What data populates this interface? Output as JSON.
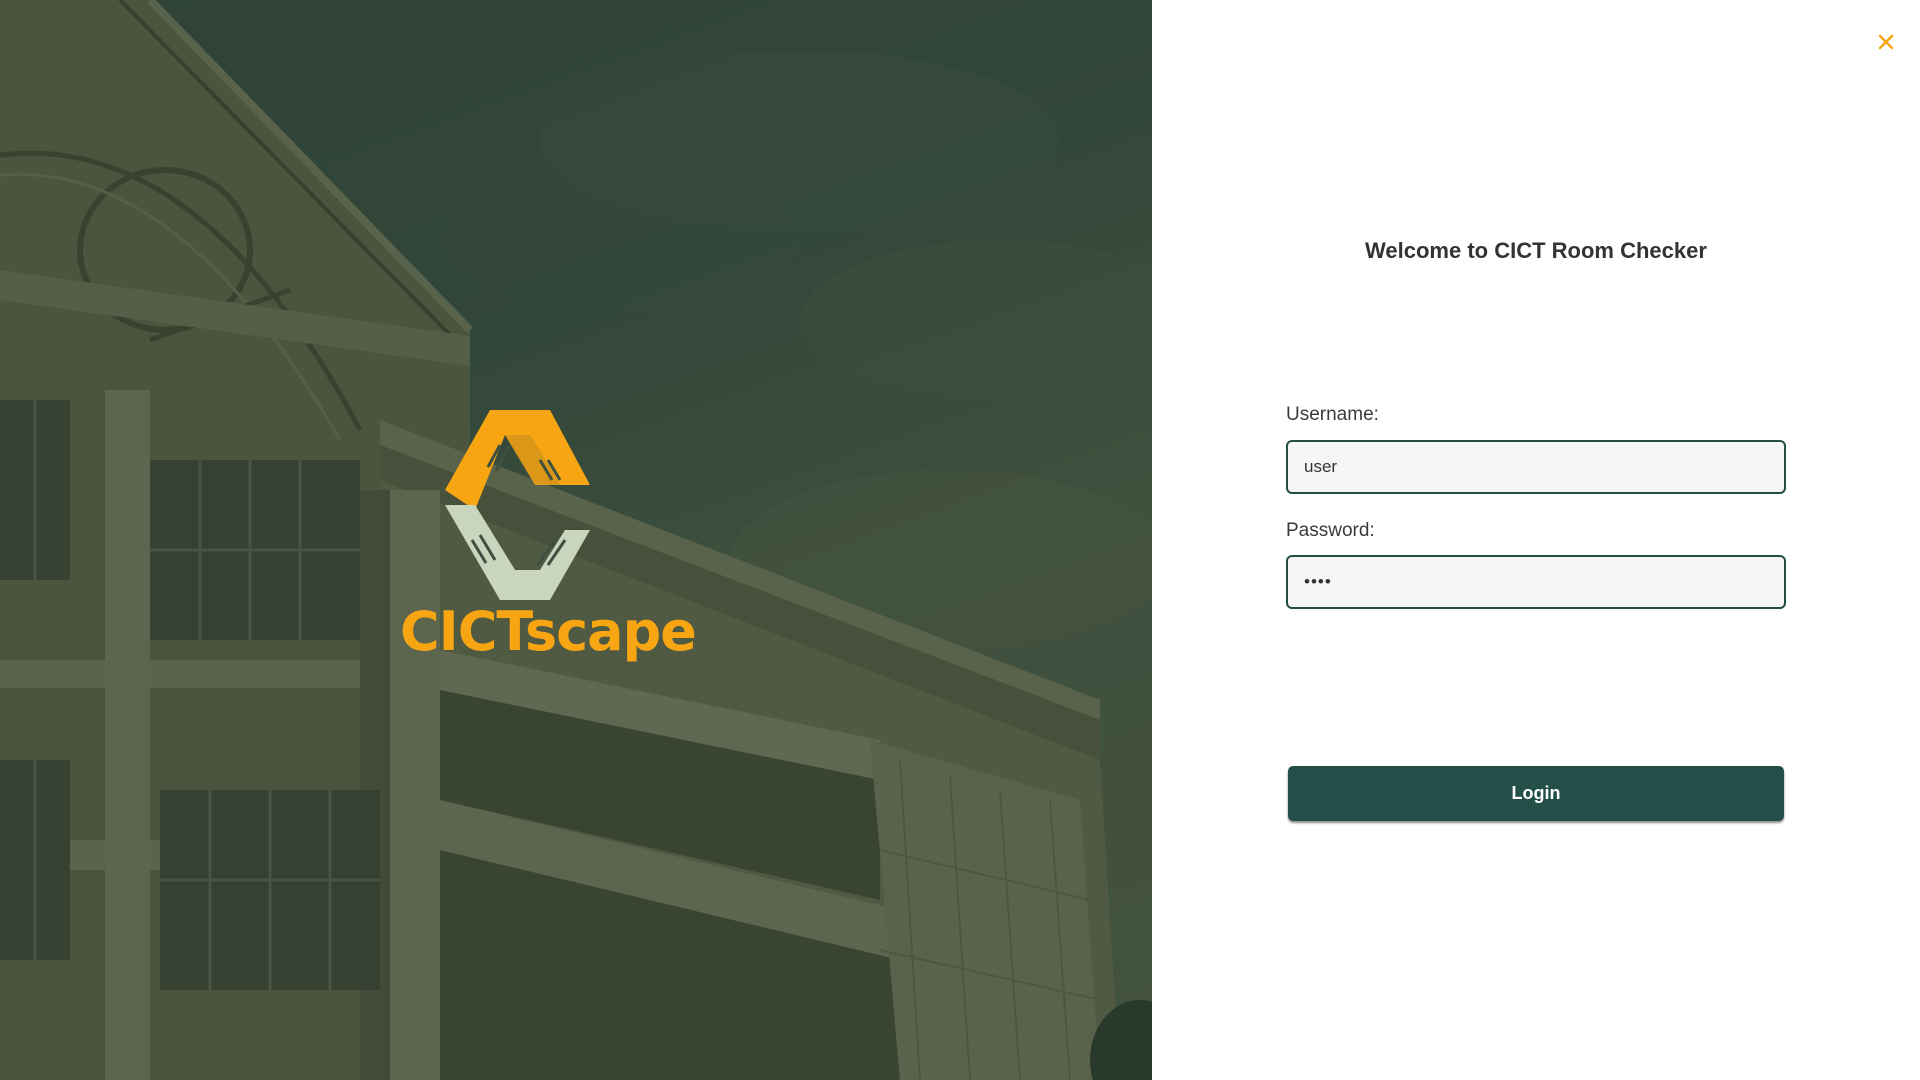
{
  "hero": {
    "logo_text": "CICTscape",
    "logo_icon": "cictscape-logo-icon"
  },
  "login": {
    "close_icon": "close-icon",
    "welcome_title": "Welcome to CICT Room Checker",
    "username_label": "Username:",
    "username_value": "user",
    "password_label": "Password:",
    "password_value": "1234",
    "login_button": "Login"
  },
  "colors": {
    "accent_orange": "#f7a512",
    "primary_green": "#234f48",
    "logo_light": "#c9d5bd"
  }
}
